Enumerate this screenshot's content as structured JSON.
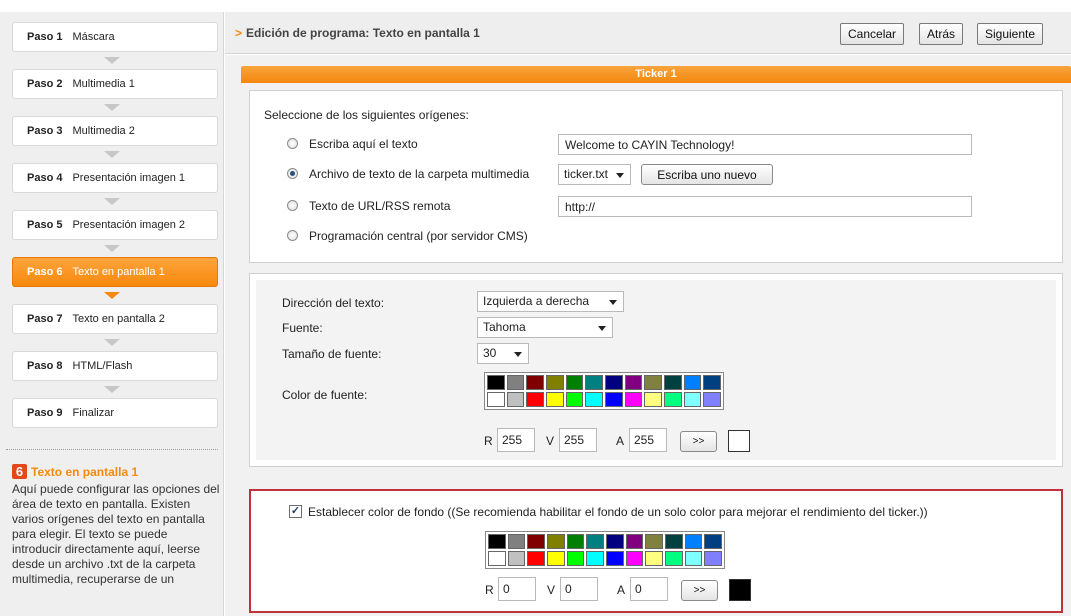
{
  "steps": [
    {
      "num": "Paso 1",
      "label": "Máscara",
      "active": false
    },
    {
      "num": "Paso 2",
      "label": "Multimedia 1",
      "active": false
    },
    {
      "num": "Paso 3",
      "label": "Multimedia 2",
      "active": false
    },
    {
      "num": "Paso 4",
      "label": "Presentación imagen 1",
      "active": false
    },
    {
      "num": "Paso 5",
      "label": "Presentación imagen 2",
      "active": false
    },
    {
      "num": "Paso 6",
      "label": "Texto en pantalla 1",
      "active": true
    },
    {
      "num": "Paso 7",
      "label": "Texto en pantalla 2",
      "active": false
    },
    {
      "num": "Paso 8",
      "label": "HTML/Flash",
      "active": false
    },
    {
      "num": "Paso 9",
      "label": "Finalizar",
      "active": false
    }
  ],
  "help": {
    "number": "6",
    "title": "Texto en pantalla 1",
    "text": "Aquí puede configurar las opciones del área de texto en pantalla. Existen varios orígenes del texto en pantalla para elegir. El texto se puede introducir directamente aquí, leerse desde un archivo .txt de la carpeta multimedia, recuperarse de un"
  },
  "header": {
    "chevron": ">",
    "title": "Edición de programa: Texto en pantalla 1",
    "cancel": "Cancelar",
    "back": "Atrás",
    "next": "Siguiente"
  },
  "ticker": {
    "tab": "Ticker 1",
    "source": {
      "heading": "Seleccione de los siguientes orígenes:",
      "opt_text": "Escriba aquí el texto",
      "opt_text_value": "Welcome to CAYIN Technology!",
      "opt_file": "Archivo de texto de la carpeta multimedia",
      "opt_file_value": "ticker.txt",
      "write_new": "Escriba uno nuevo",
      "opt_url": "Texto de URL/RSS remota",
      "opt_url_value": "http://",
      "opt_cms": "Programación central (por servidor CMS)",
      "selected": "file"
    },
    "font": {
      "direction_label": "Dirección del texto:",
      "direction_value": "Izquierda a derecha",
      "font_label": "Fuente:",
      "font_value": "Tahoma",
      "size_label": "Tamaño de fuente:",
      "size_value": "30",
      "color_label": "Color de fuente:",
      "r_label": "R",
      "r": "255",
      "g_label": "V",
      "g": "255",
      "b_label": "A",
      "b": "255",
      "apply": ">>",
      "preview_color": "#ffffff"
    },
    "background": {
      "checked": true,
      "check_mark": "✓",
      "label": "Establecer color de fondo ((Se recomienda habilitar el fondo de un solo color para mejorar el rendimiento del ticker.))",
      "r_label": "R",
      "r": "0",
      "g_label": "V",
      "g": "0",
      "b_label": "A",
      "b": "0",
      "apply": ">>",
      "preview_color": "#000000"
    },
    "palette": [
      "#000000",
      "#808080",
      "#800000",
      "#808000",
      "#008000",
      "#008080",
      "#000080",
      "#800080",
      "#808040",
      "#004040",
      "#0080ff",
      "#004080",
      "#ffffff",
      "#c0c0c0",
      "#ff0000",
      "#ffff00",
      "#00ff00",
      "#00ffff",
      "#0000ff",
      "#ff00ff",
      "#ffff80",
      "#00ff80",
      "#80ffff",
      "#8080ff"
    ]
  }
}
